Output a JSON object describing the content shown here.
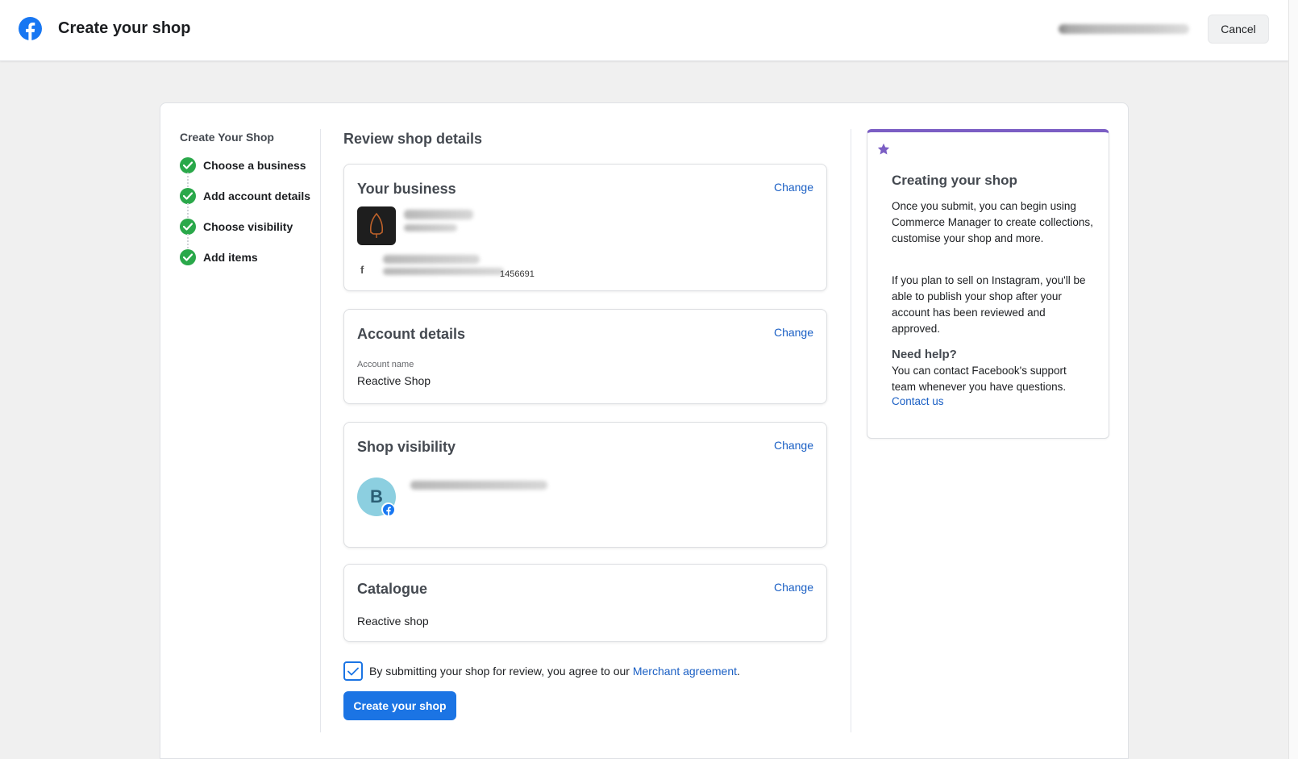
{
  "header": {
    "title": "Create your shop",
    "cancel_label": "Cancel"
  },
  "steps": {
    "title": "Create Your Shop",
    "items": [
      {
        "label": "Choose a business",
        "status": "complete"
      },
      {
        "label": "Add account details",
        "status": "complete"
      },
      {
        "label": "Choose visibility",
        "status": "complete"
      },
      {
        "label": "Add items",
        "status": "complete"
      }
    ]
  },
  "review": {
    "title": "Review shop details",
    "change_label": "Change",
    "business": {
      "title": "Your business",
      "page_id_suffix": "1456691",
      "page_icon": "f"
    },
    "account": {
      "title": "Account details",
      "field_label": "Account name",
      "field_value": "Reactive Shop"
    },
    "visibility": {
      "title": "Shop visibility",
      "avatar_letter": "B"
    },
    "catalogue": {
      "title": "Catalogue",
      "value": "Reactive shop"
    },
    "agreement": {
      "checked": true,
      "text": "By submitting your shop for review, you agree to our ",
      "link": "Merchant agreement",
      "period": "."
    },
    "submit_label": "Create your shop"
  },
  "help": {
    "title": "Creating your shop",
    "p1": "Once you submit, you can begin using Commerce Manager to create collections, customise your shop and more.",
    "p2": "If you plan to sell on Instagram, you'll be able to publish your shop after your account has been reviewed and approved.",
    "need_help": "Need help?",
    "p3": "You can contact Facebook's support team whenever you have questions.",
    "contact": "Contact us",
    "accent_color": "#7b5ec4"
  },
  "colors": {
    "brand": "#1b74e4",
    "success": "#2aa84a"
  }
}
